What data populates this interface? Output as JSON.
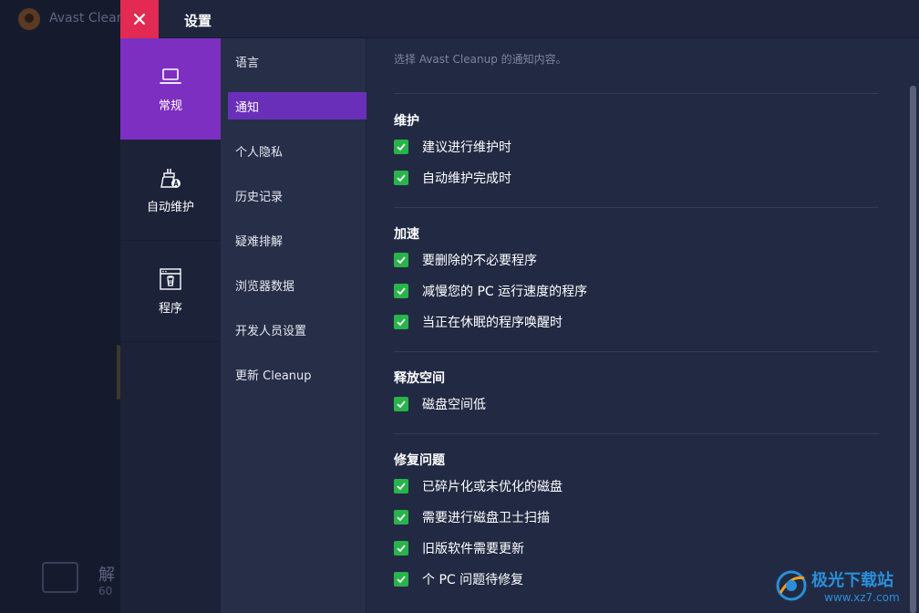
{
  "background_app": {
    "title": "Avast Cleanup",
    "card_title": "解",
    "card_sub": "60"
  },
  "dialog": {
    "title": "设置"
  },
  "categories": [
    {
      "label": "常规",
      "icon": "laptop-icon",
      "active": true
    },
    {
      "label": "自动维护",
      "icon": "auto-maintenance-icon",
      "active": false
    },
    {
      "label": "程序",
      "icon": "program-trash-icon",
      "active": false
    }
  ],
  "subnav": [
    {
      "label": "语言",
      "active": false
    },
    {
      "label": "通知",
      "active": true
    },
    {
      "label": "个人隐私",
      "active": false
    },
    {
      "label": "历史记录",
      "active": false
    },
    {
      "label": "疑难排解",
      "active": false
    },
    {
      "label": "浏览器数据",
      "active": false
    },
    {
      "label": "开发人员设置",
      "active": false
    },
    {
      "label": "更新 Cleanup",
      "active": false
    }
  ],
  "content": {
    "intro": "选择 Avast Cleanup 的通知内容。",
    "sections": [
      {
        "title": "维护",
        "items": [
          {
            "label": "建议进行维护时",
            "checked": true
          },
          {
            "label": "自动维护完成时",
            "checked": true
          }
        ]
      },
      {
        "title": "加速",
        "items": [
          {
            "label": "要删除的不必要程序",
            "checked": true
          },
          {
            "label": "减慢您的 PC 运行速度的程序",
            "checked": true
          },
          {
            "label": "当正在休眠的程序唤醒时",
            "checked": true
          }
        ]
      },
      {
        "title": "释放空间",
        "items": [
          {
            "label": "磁盘空间低",
            "checked": true
          }
        ]
      },
      {
        "title": "修复问题",
        "items": [
          {
            "label": "已碎片化或未优化的磁盘",
            "checked": true
          },
          {
            "label": "需要进行磁盘卫士扫描",
            "checked": true
          },
          {
            "label": "旧版软件需要更新",
            "checked": true
          },
          {
            "label": "个 PC 问题待修复",
            "checked": true
          }
        ]
      }
    ]
  },
  "watermark": {
    "text": "极光下载站",
    "url": "www.xz7.com"
  },
  "colors": {
    "close": "#e22a52",
    "active_category": "#7d2fc2",
    "active_subnav": "#6a2fb8",
    "checkbox": "#28b44a",
    "panel": "#222a43"
  }
}
